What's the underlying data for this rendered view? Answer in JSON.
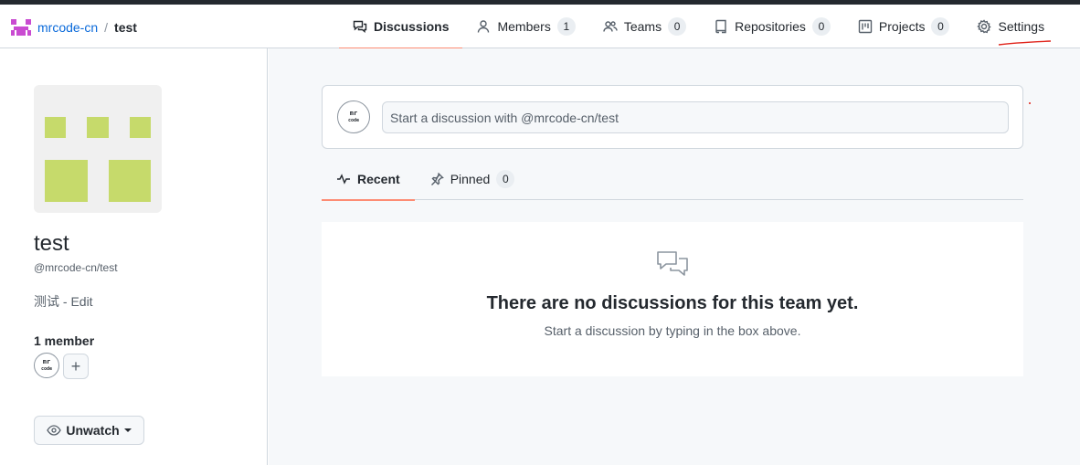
{
  "breadcrumb": {
    "org": "mrcode-cn",
    "separator": "/",
    "team": "test"
  },
  "tabs": [
    {
      "label": "Discussions",
      "icon": "comment-discussion-icon",
      "selected": true
    },
    {
      "label": "Members",
      "count": "1",
      "icon": "person-icon"
    },
    {
      "label": "Teams",
      "count": "0",
      "icon": "people-icon"
    },
    {
      "label": "Repositories",
      "count": "0",
      "icon": "repo-icon"
    },
    {
      "label": "Projects",
      "count": "0",
      "icon": "project-icon"
    },
    {
      "label": "Settings",
      "icon": "gear-icon"
    }
  ],
  "sidebar": {
    "team_name": "test",
    "team_slug": "@mrcode-cn/test",
    "description": "测试 - Edit",
    "members_title": "1 member",
    "add_member": "+",
    "unwatch_label": "Unwatch",
    "avatar_logo": "mrcode"
  },
  "composer": {
    "placeholder": "Start a discussion with @mrcode-cn/test"
  },
  "subtabs": [
    {
      "label": "Recent",
      "icon": "pulse-icon",
      "selected": true
    },
    {
      "label": "Pinned",
      "count": "0",
      "icon": "pin-icon"
    }
  ],
  "blankslate": {
    "title": "There are no discussions for this team yet.",
    "subtitle": "Start a discussion by typing in the box above."
  },
  "colors": {
    "accent_underline": "#fd8c73",
    "link": "#0969da",
    "avatar_green": "#c6da6b",
    "org_magenta": "#c94bd1",
    "annotation_red": "#e5534b"
  }
}
